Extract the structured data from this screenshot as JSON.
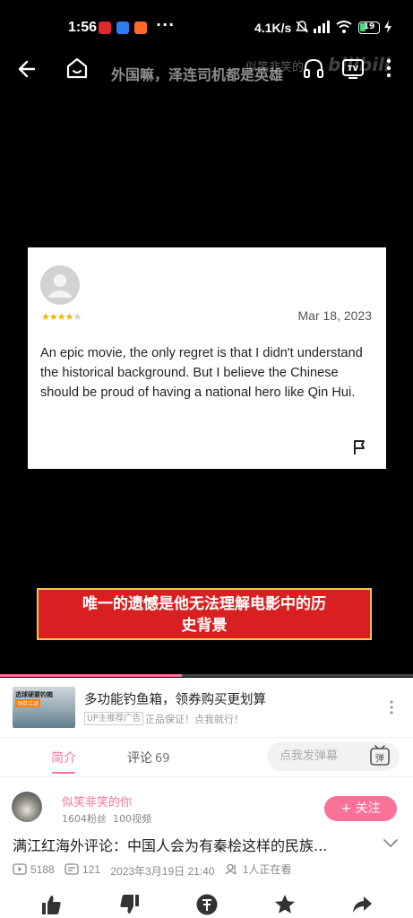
{
  "status_bar": {
    "time": "1:56",
    "more": "···",
    "network_speed": "4.1K/s",
    "battery": "19",
    "colors": {
      "battery_fill": "#3ddc84"
    }
  },
  "player": {
    "title": "外国嘛，泽连司机都是英雄",
    "watermark": "似笑非笑的",
    "logo_text": "bilibili",
    "review": {
      "rating": 4,
      "max_rating": 5,
      "date": "Mar 18, 2023",
      "text": "An epic movie, the only regret is that I didn't understand the historical background. But I believe the Chinese should be proud of having a national hero like Qin Hui."
    },
    "subtitle_line1": "唯一的遗憾是他无法理解电影中的历",
    "subtitle_line2": "史背景",
    "progress": 0.44,
    "colors": {
      "accent": "#fb7299",
      "subtitle_bg": "#d92020",
      "subtitle_border": "#f2c94c"
    }
  },
  "ad": {
    "thumb_text": "选球硬要钓箱",
    "thumb_badge": "领券立减",
    "title": "多功能钓鱼箱，领券购买更划算",
    "tag": "UP主推荐广告",
    "slogan": "正品保证！点我就行！"
  },
  "tabs": {
    "intro": "简介",
    "comments": "评论",
    "comments_count": "69",
    "danmaku_placeholder": "点我发弹幕",
    "danmaku_button": "弹"
  },
  "uploader": {
    "name": "似笑非笑的你",
    "fans": "1604粉丝",
    "videos": "100视频",
    "follow_label": "+ 关注"
  },
  "video": {
    "title": "满江红海外评论：中国人会为有秦桧这样的民族...",
    "views": "5188",
    "danmaku": "121",
    "date": "2023年3月19日 21:40",
    "watching": "1人正在看"
  }
}
